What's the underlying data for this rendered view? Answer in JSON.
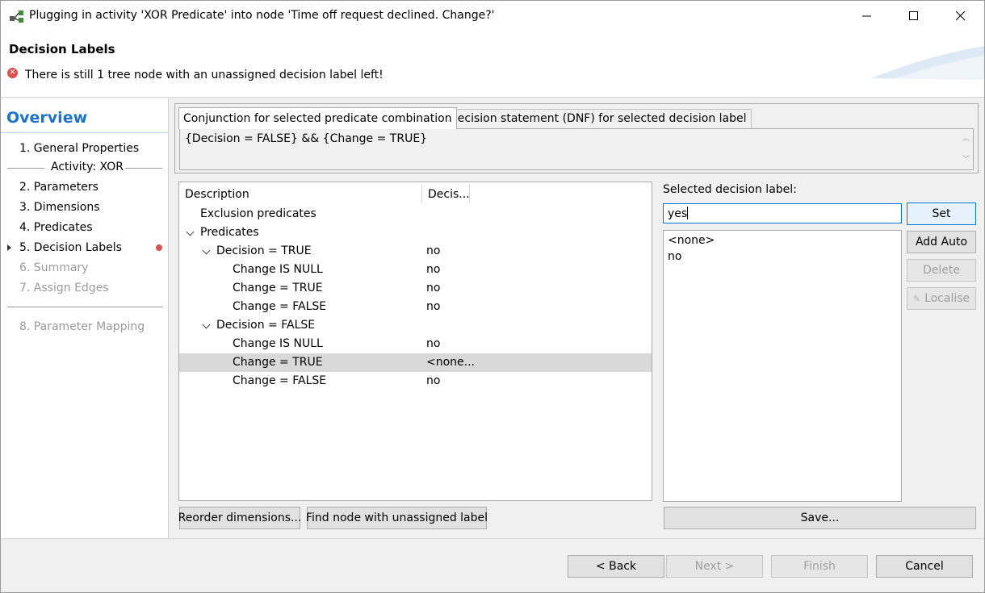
{
  "window": {
    "title": "Plugging in activity 'XOR Predicate' into node 'Time off request declined. Change?'"
  },
  "header": {
    "title": "Decision Labels",
    "message": "There is still 1 tree node with an unassigned decision label left!"
  },
  "nav": {
    "overview": "Overview",
    "items": [
      {
        "label": "1.  General Properties"
      },
      {
        "label": "2.  Parameters"
      },
      {
        "label": "3.  Dimensions"
      },
      {
        "label": "4.  Predicates"
      },
      {
        "label": "5.  Decision Labels"
      },
      {
        "label": "6.  Summary"
      },
      {
        "label": "7.  Assign Edges"
      },
      {
        "label": "8.  Parameter Mapping"
      }
    ],
    "sub_header": "Activity: XOR"
  },
  "tabs": [
    {
      "label": "Conjunction for selected predicate combination"
    },
    {
      "label": "Decision statement (DNF) for selected decision label"
    }
  ],
  "conjunction_text": "{Decision = FALSE} && {Change = TRUE}",
  "tree": {
    "columns": [
      "Description",
      "Decis..."
    ],
    "rows": [
      {
        "desc": "Exclusion predicates",
        "dec": ""
      },
      {
        "desc": "Predicates",
        "dec": ""
      },
      {
        "desc": "Decision = TRUE",
        "dec": ""
      },
      {
        "desc": "Change IS NULL",
        "dec": "no"
      },
      {
        "desc": "Change = TRUE",
        "dec": "no"
      },
      {
        "desc": "Change = FALSE",
        "dec": "no"
      },
      {
        "desc": "Decision = FALSE",
        "dec": ""
      },
      {
        "desc": "Change IS NULL",
        "dec": "no"
      },
      {
        "desc": "Change = TRUE",
        "dec": "<none..."
      },
      {
        "desc": "Change = FALSE",
        "dec": "no"
      }
    ],
    "decision_true_value": "no"
  },
  "buttons": {
    "reorder": "Reorder dimensions...",
    "find_unassigned": "Find node with unassigned label",
    "set": "Set",
    "add_auto": "Add Auto",
    "delete": "Delete",
    "localise": "Localise",
    "save": "Save...",
    "back": "< Back",
    "next": "Next >",
    "finish": "Finish",
    "cancel": "Cancel"
  },
  "right_panel": {
    "selected_label_caption": "Selected decision label:",
    "input_value": "yes",
    "labels": [
      "<none>",
      "no"
    ]
  },
  "colors": {
    "accent": "#1a73c9",
    "error": "#d9534f",
    "selection": "#d9d9d9",
    "focus": "#0078d7"
  }
}
